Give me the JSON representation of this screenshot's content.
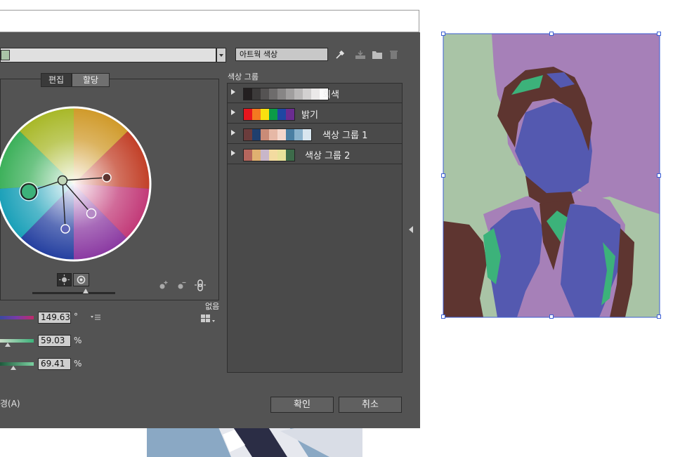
{
  "header": {
    "artwork_colors_label": "아트웍 색상"
  },
  "tabs": [
    {
      "label": "편집"
    },
    {
      "label": "할당"
    }
  ],
  "color_groups": {
    "title": "색상 그룹",
    "items": [
      {
        "label": "회색",
        "swatches": [
          "#231f20",
          "#3c3a3a",
          "#555353",
          "#6e6c6c",
          "#878585",
          "#a09e9e",
          "#b9b7b7",
          "#d2d0d0",
          "#ebe9e9",
          "#fafafa"
        ]
      },
      {
        "label": "밝기",
        "swatches": [
          "#e8161d",
          "#f47920",
          "#f9e010",
          "#0b9b48",
          "#1e47a3",
          "#6a2c90"
        ]
      },
      {
        "label": "색상 그룹 1",
        "swatches": [
          "#6b3c3c",
          "#1f3f6e",
          "#c98b77",
          "#e6b8a6",
          "#f3d6cb",
          "#4a7ea2",
          "#8ab2cc",
          "#d9e6ef"
        ]
      },
      {
        "label": "색상 그룹 2",
        "swatches": [
          "#b5665d",
          "#e0b070",
          "#c8b6c9",
          "#f3dba0",
          "#e8e29a",
          "#3d6b4a"
        ]
      }
    ]
  },
  "values": {
    "hue": "149.63",
    "hue_unit": "°",
    "saturation": "59.03",
    "saturation_unit": "%",
    "brightness": "69.41",
    "brightness_unit": "%",
    "none_label": "없음"
  },
  "footer": {
    "partial_label": "경(A)",
    "ok_label": "확인",
    "cancel_label": "취소"
  },
  "colors": {
    "dialog_bg": "#535353",
    "poster_green": "#a9c4a6",
    "poster_purple": "#a680b8",
    "poster_brown": "#5e3530",
    "poster_blue": "#5459b0",
    "poster_accent": "#3cb27a"
  }
}
